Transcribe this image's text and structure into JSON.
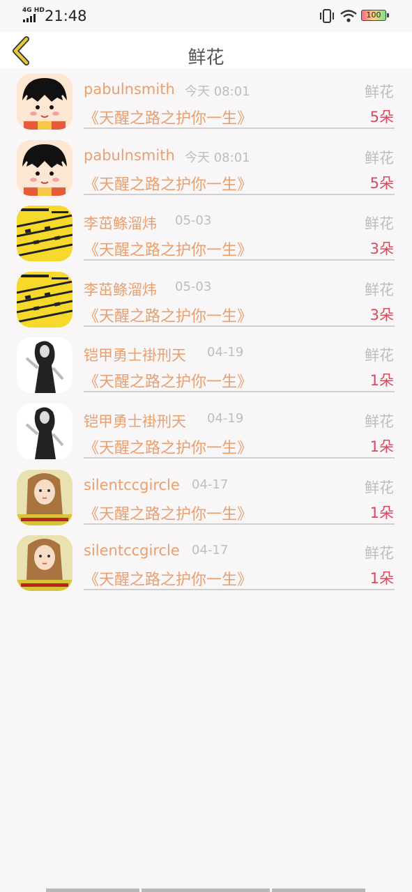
{
  "status_bar": {
    "network": "4G HD",
    "time": "21:48",
    "battery": "100"
  },
  "nav": {
    "title": "鲜花"
  },
  "rows": [
    {
      "user": "pabulnsmith",
      "time": "今天 08:01",
      "type": "鲜花",
      "gift": "《天醒之路之护你一生》",
      "count": "5朵",
      "avatar": "cartoon-girl"
    },
    {
      "user": "pabulnsmith",
      "time": "今天 08:01",
      "type": "鲜花",
      "gift": "《天醒之路之护你一生》",
      "count": "5朵",
      "avatar": "cartoon-girl"
    },
    {
      "user": "李茁鲦溜炜",
      "time": "05-03",
      "type": "鲜花",
      "gift": "《天醒之路之护你一生》",
      "count": "3朵",
      "avatar": "yellow-comic"
    },
    {
      "user": "李茁鲦溜炜",
      "time": "05-03",
      "type": "鲜花",
      "gift": "《天醒之路之护你一生》",
      "count": "3朵",
      "avatar": "yellow-comic"
    },
    {
      "user": "铠甲勇士褂刑天",
      "time": "04-19",
      "type": "鲜花",
      "gift": "《天醒之路之护你一生》",
      "count": "1朵",
      "avatar": "bw-woman"
    },
    {
      "user": "铠甲勇士褂刑天",
      "time": "04-19",
      "type": "鲜花",
      "gift": "《天醒之路之护你一生》",
      "count": "1朵",
      "avatar": "bw-woman"
    },
    {
      "user": "silentccgircle",
      "time": "04-17",
      "type": "鲜花",
      "gift": "《天醒之路之护你一生》",
      "count": "1朵",
      "avatar": "doll-girl"
    },
    {
      "user": "silentccgircle",
      "time": "04-17",
      "type": "鲜花",
      "gift": "《天醒之路之护你一生》",
      "count": "1朵",
      "avatar": "doll-girl"
    }
  ],
  "colors": {
    "accent": "#e8a070",
    "count": "#d64a5e",
    "muted": "#bdbdbd",
    "back_arrow": "#e8c640"
  }
}
